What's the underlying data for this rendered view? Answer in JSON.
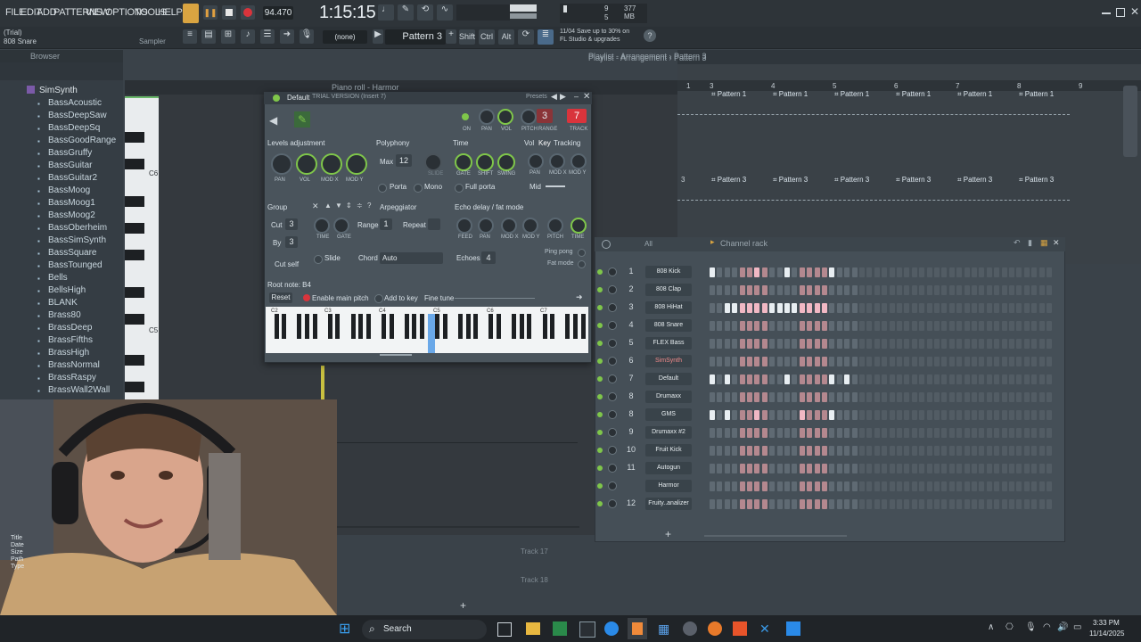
{
  "menu": {
    "items": [
      "FILE",
      "EDIT",
      "ADD",
      "PATTERNS",
      "VIEW",
      "OPTIONS",
      "TOOLS",
      "HELP"
    ],
    "tempo": "94.470",
    "time": "1:15:15",
    "memory": "377 MB",
    "cpu_value": "9",
    "poly_value": "5",
    "trial": "(Trial)",
    "hint_channel": "808 Snare",
    "hint_sampler": "Sampler",
    "pattern": "Pattern 3",
    "none": "(none)",
    "news_line1": "11/04  Save up to 30% on",
    "news_line2": "FL Studio & upgrades",
    "shift": "Shift",
    "ctrl": "Ctrl",
    "alt": "Alt"
  },
  "browser": {
    "title": "Browser",
    "folder": "SimSynth",
    "items": [
      "BassAcoustic",
      "BassDeepSaw",
      "BassDeepSq",
      "BassGoodRange",
      "BassGruffy",
      "BassGuitar",
      "BassGuitar2",
      "BassMoog",
      "BassMoog1",
      "BassMoog2",
      "BassOberheim",
      "BassSimSynth",
      "BassSquare",
      "BassTounged",
      "Bells",
      "BellsHigh",
      "BLANK",
      "Brass80",
      "BrassDeep",
      "BrassFifths",
      "BrassHigh",
      "BrassNormal",
      "BrassRaspy",
      "BrassWall2Wall"
    ]
  },
  "pianoroll": {
    "title": "Piano roll - Harmor",
    "octave_c6": "C6",
    "octave_c5": "C5",
    "tracks": [
      "Track 17",
      "Track 18"
    ]
  },
  "playlist": {
    "title": "Playlist - Arrangement › Pattern 3",
    "ruler": [
      "3",
      "4",
      "5",
      "6",
      "7",
      "8",
      "9"
    ],
    "row1": [
      "Pattern 1",
      "Pattern 1",
      "Pattern 1",
      "Pattern 1",
      "Pattern 1",
      "Pattern 1"
    ],
    "row2": [
      "Pattern 3",
      "Pattern 3",
      "Pattern 3",
      "Pattern 3",
      "Pattern 3",
      "Pattern 3"
    ],
    "ruler_left": "1",
    "row2_left": "3"
  },
  "plugin": {
    "title": "Default",
    "title_suffix": "TRIAL VERSION (Insert 7)",
    "presets": "Presets",
    "track_num": "7",
    "mix_num": "3",
    "small_labels": [
      "ON",
      "PAN",
      "VOL",
      "PITCH",
      "RANGE",
      "TRACK"
    ],
    "levels_title": "Levels adjustment",
    "levels_knobs": [
      "PAN",
      "VOL",
      "MOD X",
      "MOD Y"
    ],
    "polyphony_title": "Polyphony",
    "max_label": "Max",
    "max_value": "12",
    "slide_label": "SLIDE",
    "porta_label": "Porta",
    "mono_label": "Mono",
    "time_title": "Time",
    "time_knobs": [
      "GATE",
      "SHIFT",
      "SWING"
    ],
    "full_porta": "Full porta",
    "vol_label": "Vol",
    "key_label": "Key",
    "tracking_label": "Tracking",
    "tracking_knobs": [
      "PAN",
      "MOD X",
      "MOD Y"
    ],
    "mid_label": "Mid",
    "group_title": "Group",
    "arp_title": "Arpeggiator",
    "cut_label": "Cut",
    "cut_value": "3",
    "by_label": "By",
    "by_value": "3",
    "cut_self": "Cut self",
    "arp_knobs": [
      "TIME",
      "GATE"
    ],
    "range_label": "Range",
    "range_value": "1",
    "repeat_label": "Repeat",
    "slide": "Slide",
    "chord_label": "Chord",
    "chord_value": "Auto",
    "echo_title": "Echo delay / fat mode",
    "echo_knobs": [
      "FEED",
      "PAN",
      "MOD X",
      "MOD Y",
      "PITCH",
      "TIME"
    ],
    "echoes_label": "Echoes",
    "echoes_value": "4",
    "ping_pong": "Ping pong",
    "fat_mode": "Fat mode",
    "root_note": "Root note: B4",
    "reset": "Reset",
    "enable_main_pitch": "Enable main pitch",
    "add_to_key": "Add to key",
    "fine_tune": "Fine tune",
    "octaves": [
      "C2",
      "C3",
      "C4",
      "C5",
      "C6",
      "C7"
    ]
  },
  "rack": {
    "title": "Channel rack",
    "filter": "All",
    "channels": [
      {
        "num": "1",
        "name": "808 Kick",
        "steps": [
          1,
          0,
          0,
          0,
          0,
          0,
          1,
          0,
          0,
          0,
          1,
          0,
          0,
          0,
          0,
          0,
          1,
          0,
          0,
          0
        ]
      },
      {
        "num": "2",
        "name": "808 Clap",
        "steps": [
          0,
          0,
          0,
          0,
          0,
          0,
          0,
          0,
          0,
          0,
          0,
          0,
          0,
          0,
          0,
          0,
          0,
          0,
          0,
          0
        ]
      },
      {
        "num": "3",
        "name": "808 HiHat",
        "steps": [
          0,
          0,
          1,
          1,
          1,
          1,
          1,
          1,
          1,
          1,
          1,
          1,
          1,
          1,
          1,
          1,
          0,
          0,
          0,
          0
        ]
      },
      {
        "num": "4",
        "name": "808 Snare",
        "steps": [
          0,
          0,
          0,
          0,
          0,
          0,
          0,
          0,
          0,
          0,
          0,
          0,
          0,
          0,
          0,
          0,
          0,
          0,
          0,
          0
        ]
      },
      {
        "num": "5",
        "name": "FLEX Bass",
        "steps": [
          0,
          0,
          0,
          0,
          0,
          0,
          0,
          0,
          0,
          0,
          0,
          0,
          0,
          0,
          0,
          0,
          0,
          0,
          0,
          0
        ]
      },
      {
        "num": "6",
        "name": "SimSynth",
        "steps": [
          0,
          0,
          0,
          0,
          0,
          0,
          0,
          0,
          0,
          0,
          0,
          0,
          0,
          0,
          0,
          0,
          0,
          0,
          0,
          0
        ]
      },
      {
        "num": "7",
        "name": "Default",
        "steps": [
          1,
          0,
          1,
          0,
          0,
          0,
          0,
          0,
          0,
          0,
          1,
          0,
          0,
          0,
          0,
          0,
          1,
          0,
          1,
          0
        ]
      },
      {
        "num": "8",
        "name": "Drumaxx",
        "steps": [
          0,
          0,
          0,
          0,
          0,
          0,
          0,
          0,
          0,
          0,
          0,
          0,
          0,
          0,
          0,
          0,
          0,
          0,
          0,
          0
        ]
      },
      {
        "num": "8",
        "name": "GMS",
        "steps": [
          1,
          0,
          1,
          0,
          0,
          0,
          1,
          0,
          0,
          0,
          0,
          0,
          1,
          0,
          0,
          0,
          1,
          0,
          0,
          0
        ]
      },
      {
        "num": "9",
        "name": "Drumaxx #2",
        "steps": [
          0,
          0,
          0,
          0,
          0,
          0,
          0,
          0,
          0,
          0,
          0,
          0,
          0,
          0,
          0,
          0,
          0,
          0,
          0,
          0
        ]
      },
      {
        "num": "10",
        "name": "Fruit Kick",
        "steps": [
          0,
          0,
          0,
          0,
          0,
          0,
          0,
          0,
          0,
          0,
          0,
          0,
          0,
          0,
          0,
          0,
          0,
          0,
          0,
          0
        ]
      },
      {
        "num": "11",
        "name": "Autogun",
        "steps": [
          0,
          0,
          0,
          0,
          0,
          0,
          0,
          0,
          0,
          0,
          0,
          0,
          0,
          0,
          0,
          0,
          0,
          0,
          0,
          0
        ]
      },
      {
        "num": "",
        "name": "Harmor",
        "steps": [
          0,
          0,
          0,
          0,
          0,
          0,
          0,
          0,
          0,
          0,
          0,
          0,
          0,
          0,
          0,
          0,
          0,
          0,
          0,
          0
        ]
      },
      {
        "num": "12",
        "name": "Fruity..analizer",
        "steps": [
          0,
          0,
          0,
          0,
          0,
          0,
          0,
          0,
          0,
          0,
          0,
          0,
          0,
          0,
          0,
          0,
          0,
          0,
          0,
          0
        ]
      }
    ],
    "add": "+"
  },
  "taskbar": {
    "search": "Search",
    "time": "3:33 PM",
    "date": "11/14/2025"
  },
  "webcam_overlay": {
    "lines": [
      "Title",
      "Date",
      "Size",
      "Path",
      "Type"
    ]
  },
  "colors": {
    "accent_green": "#7fc64a",
    "track_red": "#d9343c",
    "step_on": "#e8eef2",
    "step_pink": "#f1b8c4"
  }
}
